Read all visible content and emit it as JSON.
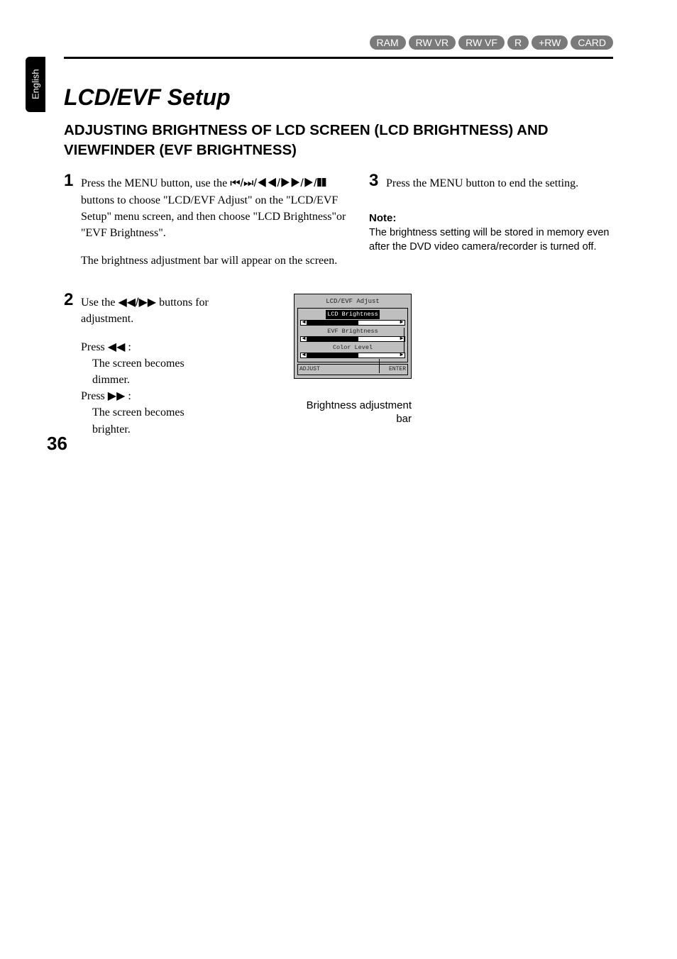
{
  "lang_tab": "English",
  "media_pills": [
    "RAM",
    "RW VR",
    "RW VF",
    "R",
    "+RW",
    "CARD"
  ],
  "title": "LCD/EVF Setup",
  "heading": "ADJUSTING BRIGHTNESS OF LCD SCREEN (LCD BRIGHTNESS) AND VIEWFINDER (EVF BRIGHTNESS)",
  "steps": {
    "s1": {
      "num": "1",
      "p1a": "Press the MENU button, use the ",
      "icons1": "⏮/⏭/◀◀/▶▶/▶/❚❚",
      "p1b": " buttons to choose \"LCD/EVF Adjust\" on the \"LCD/EVF Setup\" menu screen, and then choose \"LCD Brightness\"or \"EVF Brightness\".",
      "p2": "The brightness adjustment bar will appear on the screen."
    },
    "s2": {
      "num": "2",
      "line1a": "Use the ",
      "icons": "◀◀/▶▶",
      "line1b": " buttons for adjustment.",
      "pressL": "Press ◀◀ :",
      "pressL_eff": "The screen becomes dimmer.",
      "pressR": "Press ▶▶ :",
      "pressR_eff": "The screen becomes brighter."
    },
    "s3": {
      "num": "3",
      "text": "Press the MENU button to end the setting."
    }
  },
  "note": {
    "head": "Note:",
    "body": "The brightness setting will be stored in memory even after the DVD video camera/recorder is turned off."
  },
  "osd": {
    "title": "LCD/EVF Adjust",
    "row1": "LCD Brightness",
    "row2": "EVF Brightness",
    "row3": "Color Level",
    "hint1": "ADJUST",
    "hint2": "ENTER",
    "caption": "Brightness adjustment bar"
  },
  "page_number": "36"
}
